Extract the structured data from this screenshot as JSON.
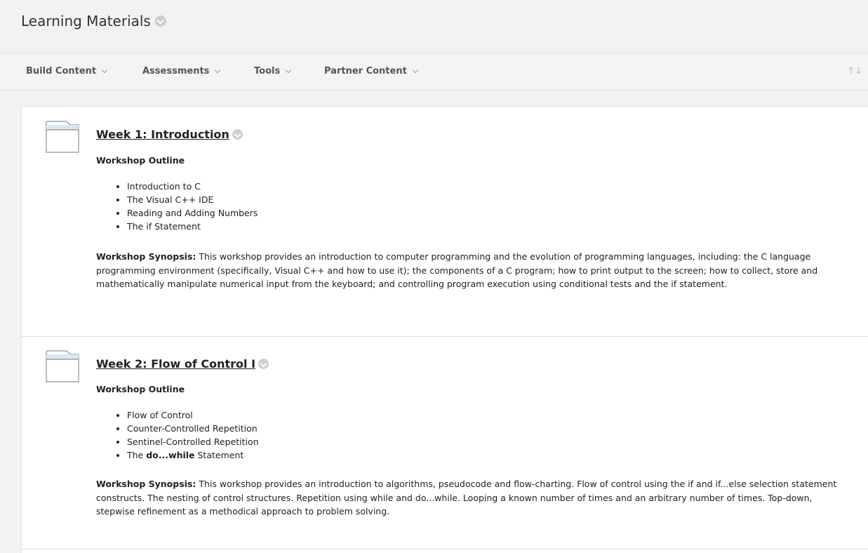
{
  "header": {
    "title": "Learning Materials"
  },
  "toolbar": {
    "items": [
      {
        "label": "Build Content"
      },
      {
        "label": "Assessments"
      },
      {
        "label": "Tools"
      },
      {
        "label": "Partner Content"
      }
    ],
    "sort_icon": "↑↓"
  },
  "items": [
    {
      "title": "Week 1: Introduction",
      "outline_label": "Workshop Outline",
      "outline": [
        {
          "text": "Introduction to C"
        },
        {
          "text": "The Visual C++ IDE"
        },
        {
          "text": "Reading and Adding Numbers"
        },
        {
          "text": "The if Statement"
        }
      ],
      "synopsis_label": "Workshop Synopsis:",
      "synopsis_text": " This workshop provides an introduction to computer programming and the evolution of programming languages, including: the C language programming environment (specifically, Visual C++ and how to use it); the components of a C program; how to print output to the screen; how to collect, store and mathematically manipulate numerical input from the keyboard; and controlling program execution using conditional tests and the if statement."
    },
    {
      "title": "Week 2: Flow of Control I",
      "outline_label": "Workshop Outline",
      "outline": [
        {
          "text": "Flow of Control"
        },
        {
          "text": "Counter-Controlled Repetition"
        },
        {
          "text": "Sentinel-Controlled Repetition"
        },
        {
          "prefix": "The ",
          "bold": "do...while",
          "suffix": " Statement"
        }
      ],
      "synopsis_label": "Workshop Synopsis:",
      "synopsis_text": " This workshop provides an introduction to algorithms, pseudocode and flow-charting. Flow of control using the if and if...else selection statement constructs. The nesting of control structures. Repetition using while and do...while. Looping a known number of times and an arbitrary number of times. Top-down, stepwise refinement as a methodical approach to problem solving."
    }
  ]
}
